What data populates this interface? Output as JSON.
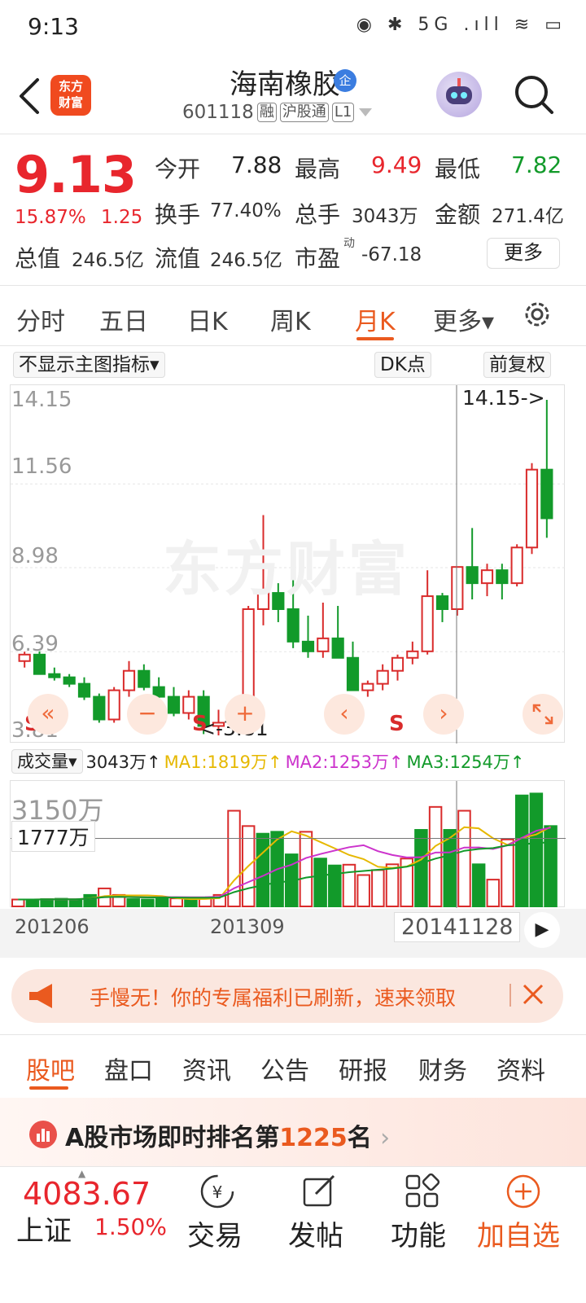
{
  "status_bar": {
    "time": "9:13",
    "icons": "◉ ✱ 5G .ıll ≋ ▭"
  },
  "header": {
    "logo_text": "东方\n财富",
    "stock_name": "海南橡胶",
    "corp_badge": "企",
    "stock_code": "601118",
    "tags": [
      "融",
      "沪股通",
      "L1"
    ]
  },
  "quote": {
    "price": "9.13",
    "change_pct": "15.87%",
    "change_amt": "1.25",
    "open_label": "今开",
    "open": "7.88",
    "high_label": "最高",
    "high": "9.49",
    "low_label": "最低",
    "low": "7.82",
    "turnover_label": "换手",
    "turnover": "77.40%",
    "volume_label": "总手",
    "volume": "3043万",
    "amount_label": "金额",
    "amount": "271.4亿",
    "mktcap_label": "总值",
    "mktcap": "246.5亿",
    "float_label": "流值",
    "float_cap": "246.5亿",
    "pe_label": "市盈",
    "pe_sup": "动",
    "pe": "-67.18",
    "more_label": "更多"
  },
  "period_tabs": [
    "分时",
    "五日",
    "日K",
    "周K",
    "月K",
    "更多▾"
  ],
  "chart_toolbar": {
    "indicator": "不显示主图指标▾",
    "dk": "DK点",
    "adjust": "前复权"
  },
  "chart_data": {
    "type": "candlestick",
    "y_ticks": [
      "14.15",
      "11.56",
      "8.98",
      "6.39",
      "3.81"
    ],
    "ylim": [
      3.81,
      14.15
    ],
    "annotations": [
      "14.15->",
      "<-3.81"
    ],
    "signals": [
      "S",
      "S",
      "S"
    ],
    "candles": [
      [
        6.1,
        6.39,
        5.9,
        6.3
      ],
      [
        6.3,
        6.4,
        5.7,
        5.7
      ],
      [
        5.7,
        5.9,
        5.5,
        5.6
      ],
      [
        5.6,
        5.7,
        5.3,
        5.4
      ],
      [
        5.4,
        5.6,
        4.9,
        5.0
      ],
      [
        5.0,
        5.1,
        4.2,
        4.3
      ],
      [
        4.3,
        5.3,
        4.2,
        5.2
      ],
      [
        5.2,
        6.1,
        5.0,
        5.8
      ],
      [
        5.8,
        6.0,
        5.2,
        5.3
      ],
      [
        5.3,
        5.6,
        4.9,
        5.0
      ],
      [
        5.0,
        5.3,
        4.4,
        4.5
      ],
      [
        4.5,
        5.2,
        4.3,
        5.0
      ],
      [
        5.0,
        5.2,
        3.85,
        4.1
      ],
      [
        4.1,
        4.6,
        3.81,
        4.2
      ],
      [
        4.2,
        4.4,
        3.9,
        4.3
      ],
      [
        4.3,
        7.8,
        4.2,
        7.7
      ],
      [
        7.7,
        10.6,
        7.2,
        8.2
      ],
      [
        8.2,
        8.5,
        7.3,
        7.7
      ],
      [
        7.7,
        8.6,
        6.5,
        6.7
      ],
      [
        6.7,
        7.5,
        6.2,
        6.4
      ],
      [
        6.4,
        7.9,
        6.2,
        6.8
      ],
      [
        6.8,
        7.8,
        6.3,
        6.2
      ],
      [
        6.2,
        6.7,
        5.6,
        5.2
      ],
      [
        5.2,
        5.5,
        5.0,
        5.4
      ],
      [
        5.4,
        6.0,
        5.2,
        5.8
      ],
      [
        5.8,
        6.3,
        5.5,
        6.2
      ],
      [
        6.2,
        6.7,
        6.0,
        6.4
      ],
      [
        6.4,
        8.9,
        6.3,
        8.1
      ],
      [
        8.1,
        8.2,
        7.3,
        7.7
      ],
      [
        7.7,
        9.0,
        7.5,
        9.0
      ],
      [
        9.0,
        10.2,
        8.0,
        8.5
      ],
      [
        8.5,
        9.1,
        8.1,
        8.9
      ],
      [
        8.9,
        9.1,
        8.0,
        8.5
      ],
      [
        8.5,
        9.7,
        8.4,
        9.6
      ],
      [
        9.6,
        12.2,
        9.4,
        12.0
      ],
      [
        12.0,
        14.15,
        9.9,
        10.5
      ]
    ]
  },
  "volume_panel": {
    "label": "成交量▾",
    "current": "3043万↑",
    "ma1": "MA1:1819万↑",
    "ma2": "MA2:1253万↑",
    "ma3": "MA3:1254万↑",
    "max_label": "3150万",
    "ref_label": "1777万",
    "colors": {
      "ma1": "#e6b800",
      "ma2": "#cc33cc",
      "ma3": "#129a2a"
    },
    "volumes": [
      180,
      180,
      190,
      200,
      180,
      300,
      470,
      300,
      190,
      180,
      200,
      210,
      170,
      210,
      300,
      2500,
      2100,
      1900,
      1950,
      1360,
      1950,
      1250,
      1070,
      1090,
      820,
      950,
      1100,
      1250,
      2000,
      2600,
      2000,
      2500,
      1100,
      700,
      1750,
      2900,
      2950,
      2100
    ]
  },
  "dates": [
    "201206",
    "201309",
    "20141128"
  ],
  "banner": {
    "text": "手慢无！你的专属福利已刷新，速来领取"
  },
  "sub_tabs": [
    "股吧",
    "盘口",
    "资讯",
    "公告",
    "研报",
    "财务",
    "资料"
  ],
  "rank": {
    "prefix": "A股市场即时排名第",
    "number": "1225",
    "suffix": "名",
    "arrow": "›"
  },
  "bottom_bar": {
    "index_value": "4083.67",
    "index_name": "上证",
    "index_pct": "1.50%",
    "buttons": [
      "交易",
      "发帖",
      "功能",
      "加自选"
    ]
  }
}
